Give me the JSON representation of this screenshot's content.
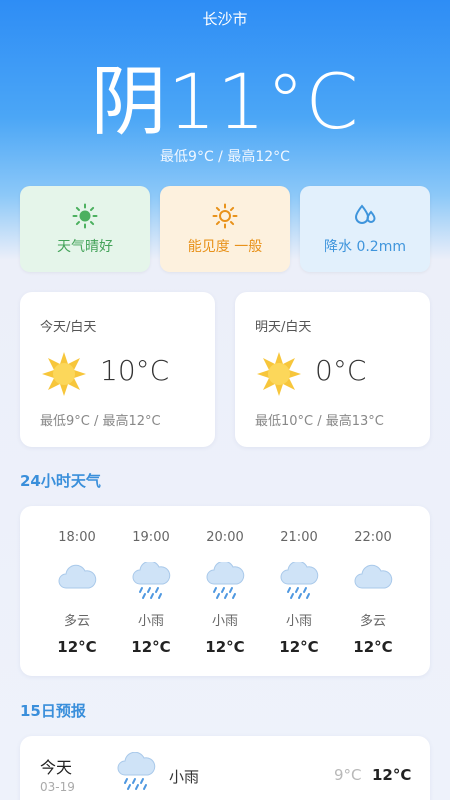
{
  "header": {
    "city": "长沙市",
    "current": "阴11°C",
    "range": "最低9°C / 最高12°C"
  },
  "chips": [
    {
      "label": "天气晴好",
      "icon": "sun-icon",
      "color": "#44a35a"
    },
    {
      "label": "能见度 一般",
      "icon": "sun-icon",
      "color": "#e8921b"
    },
    {
      "label": "降水 0.2mm",
      "icon": "raindrop-icon",
      "color": "#3f95dc"
    }
  ],
  "today": {
    "label": "今天/白天",
    "icon": "sun-icon",
    "temp": "10°C",
    "range": "最低9°C / 最高12°C"
  },
  "tomorrow": {
    "label": "明天/白天",
    "icon": "sun-icon",
    "temp": "0°C",
    "range": "最低10°C / 最高13°C"
  },
  "hourly": {
    "title": "24小时天气",
    "items": [
      {
        "time": "18:00",
        "icon": "cloud-icon",
        "cond": "多云",
        "temp": "12°C"
      },
      {
        "time": "19:00",
        "icon": "rain-cloud-icon",
        "cond": "小雨",
        "temp": "12°C"
      },
      {
        "time": "20:00",
        "icon": "rain-cloud-icon",
        "cond": "小雨",
        "temp": "12°C"
      },
      {
        "time": "21:00",
        "icon": "rain-cloud-icon",
        "cond": "小雨",
        "temp": "12°C"
      },
      {
        "time": "22:00",
        "icon": "cloud-icon",
        "cond": "多云",
        "temp": "12°C"
      }
    ]
  },
  "forecast": {
    "title": "15日预报",
    "items": [
      {
        "day": "今天",
        "date": "03-19",
        "icon": "rain-cloud-icon",
        "cond": "小雨",
        "low": "9°C",
        "high": "12°C"
      }
    ]
  },
  "colors": {
    "accent": "#3a8fdb",
    "hero_top": "#2e8df5",
    "background": "#eceff9"
  }
}
